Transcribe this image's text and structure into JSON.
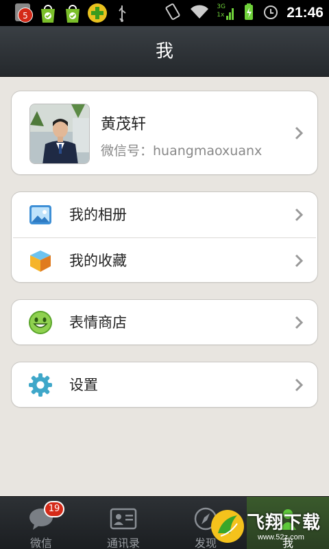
{
  "status_bar": {
    "notification_count": "5",
    "time": "21:46",
    "network_label_top": "3G",
    "network_label_bottom": "1x"
  },
  "header": {
    "title": "我"
  },
  "profile": {
    "name": "黄茂轩",
    "wechat_id_label": "微信号：",
    "wechat_id": "huangmaoxuanx"
  },
  "menu": {
    "album": {
      "label": "我的相册",
      "icon": "photo-album-icon"
    },
    "favorites": {
      "label": "我的收藏",
      "icon": "favorites-cube-icon"
    },
    "sticker_store": {
      "label": "表情商店",
      "icon": "smiley-icon"
    },
    "settings": {
      "label": "设置",
      "icon": "gear-icon"
    }
  },
  "tabs": [
    {
      "label": "微信",
      "icon": "chat-bubble-icon",
      "badge": "19"
    },
    {
      "label": "通讯录",
      "icon": "contacts-card-icon"
    },
    {
      "label": "发现",
      "icon": "compass-icon"
    },
    {
      "label": "我",
      "icon": "person-icon",
      "active": true
    }
  ],
  "watermark": {
    "text": "飞翔下载",
    "url_text": "www.52z.com"
  },
  "colors": {
    "accent_green": "#4ea32a",
    "badge_red": "#d42a18",
    "header_dark": "#2c3035"
  }
}
